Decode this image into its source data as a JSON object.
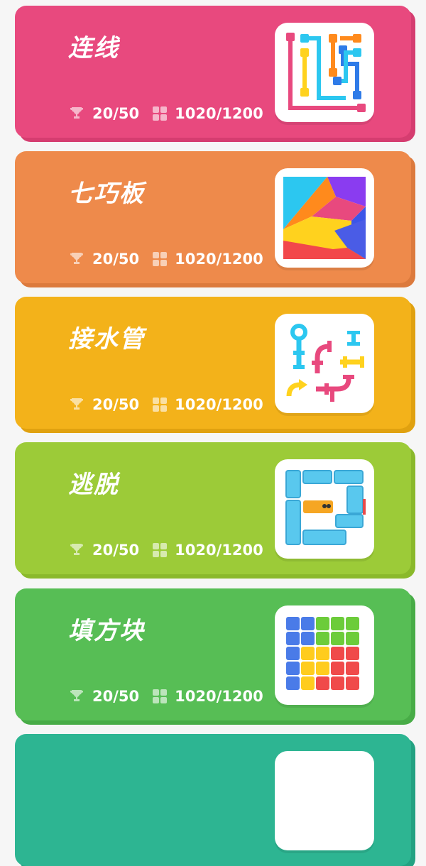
{
  "games": [
    {
      "title": "连线",
      "trophy": "20/50",
      "levels": "1020/1200",
      "color": "#e8497e",
      "shade": "#d53d70",
      "icon": "flow-lines-icon"
    },
    {
      "title": "七巧板",
      "trophy": "20/50",
      "levels": "1020/1200",
      "color": "#ee8a4b",
      "shade": "#dc7a3d",
      "icon": "tangram-icon"
    },
    {
      "title": "接水管",
      "trophy": "20/50",
      "levels": "1020/1200",
      "color": "#f3b21a",
      "shade": "#e0a110",
      "icon": "pipes-icon"
    },
    {
      "title": "逃脱",
      "trophy": "20/50",
      "levels": "1020/1200",
      "color": "#9ccb38",
      "shade": "#8ab92b",
      "icon": "escape-blocks-icon"
    },
    {
      "title": "填方块",
      "trophy": "20/50",
      "levels": "1020/1200",
      "color": "#57be55",
      "shade": "#48ac47",
      "icon": "fill-blocks-icon"
    },
    {
      "title": "",
      "trophy": "",
      "levels": "",
      "color": "#2db592",
      "shade": "#23a282",
      "icon": "partial-card"
    }
  ]
}
